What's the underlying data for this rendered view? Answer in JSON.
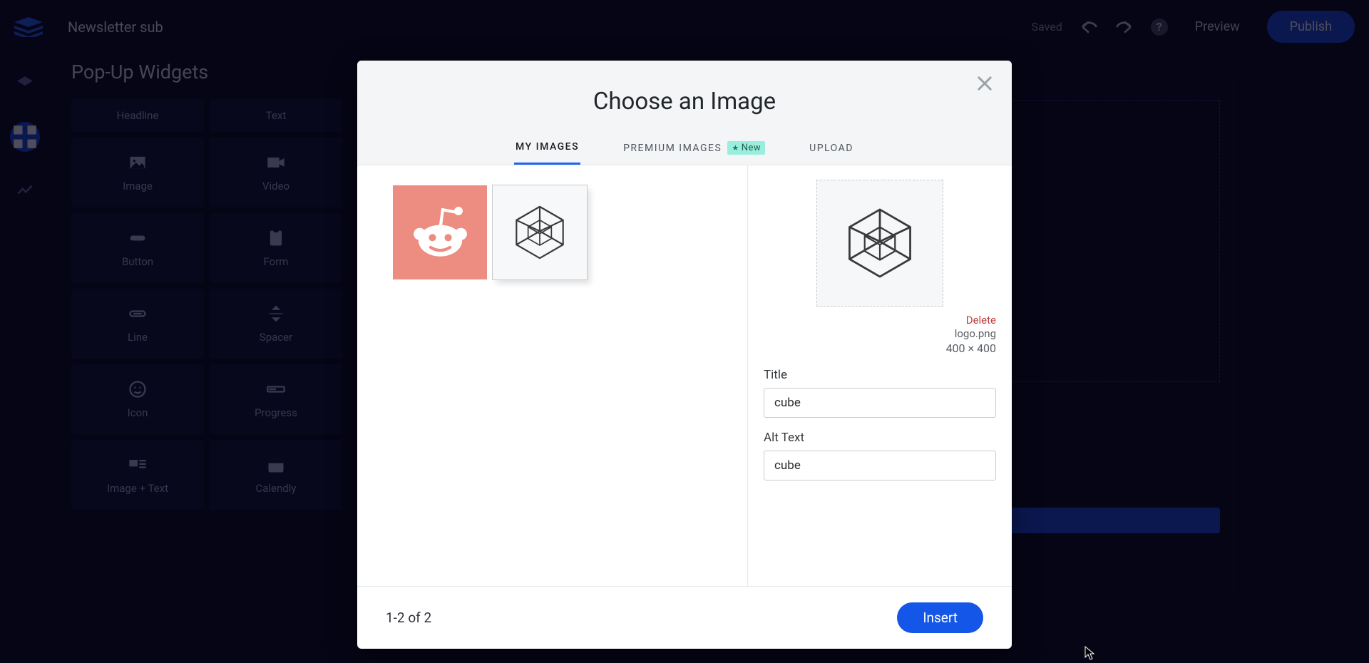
{
  "header": {
    "project_title": "Newsletter sub",
    "save_status": "Saved",
    "preview_label": "Preview",
    "publish_label": "Publish"
  },
  "sidebar_panel": {
    "title": "Pop-Up Widgets",
    "widgets": [
      {
        "label": "Headline",
        "icon": "headline"
      },
      {
        "label": "Text",
        "icon": "text"
      },
      {
        "label": "Image",
        "icon": "image"
      },
      {
        "label": "Video",
        "icon": "video"
      },
      {
        "label": "Button",
        "icon": "button"
      },
      {
        "label": "Form",
        "icon": "form"
      },
      {
        "label": "Line",
        "icon": "line"
      },
      {
        "label": "Spacer",
        "icon": "spacer"
      },
      {
        "label": "Icon",
        "icon": "icon"
      },
      {
        "label": "Progress",
        "icon": "progress"
      },
      {
        "label": "Image + Text",
        "icon": "image-text"
      },
      {
        "label": "Calendly",
        "icon": "calendly"
      }
    ]
  },
  "modal": {
    "title": "Choose an Image",
    "close_icon": "close",
    "tabs": {
      "my_images": "MY IMAGES",
      "premium_images": "PREMIUM IMAGES",
      "premium_badge": "New",
      "upload": "UPLOAD",
      "active": "my_images"
    },
    "thumbnails": [
      {
        "id": "reddit",
        "type": "reddit",
        "selected": false
      },
      {
        "id": "cube",
        "type": "cube",
        "selected": true
      }
    ],
    "details": {
      "delete_label": "Delete",
      "filename": "logo.png",
      "dimensions": "400 × 400",
      "title_label": "Title",
      "title_value": "cube",
      "alt_label": "Alt Text",
      "alt_value": "cube"
    },
    "footer": {
      "pagination": "1-2 of 2",
      "insert_label": "Insert"
    }
  }
}
